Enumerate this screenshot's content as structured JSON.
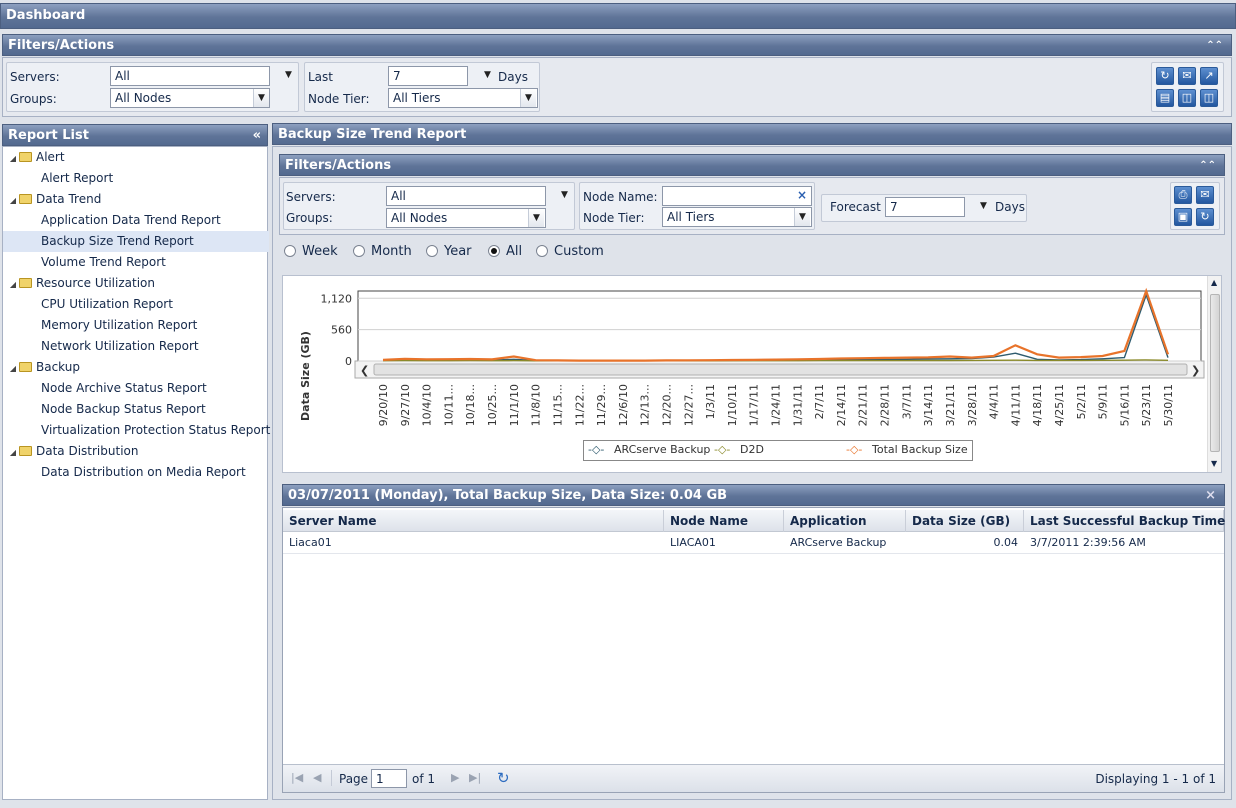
{
  "title": "Dashboard",
  "filters": {
    "title": "Filters/Actions",
    "servers_label": "Servers:",
    "servers_value": "All",
    "groups_label": "Groups:",
    "groups_value": "All Nodes",
    "last_label": "Last",
    "last_value": "7",
    "days_label": "Days",
    "node_tier_label": "Node Tier:",
    "node_tier_value": "All Tiers"
  },
  "report_list": {
    "title": "Report List",
    "items": [
      {
        "label": "Alert",
        "type": "folder"
      },
      {
        "label": "Alert Report",
        "type": "report"
      },
      {
        "label": "Data Trend",
        "type": "folder"
      },
      {
        "label": "Application Data Trend Report",
        "type": "report"
      },
      {
        "label": "Backup Size Trend Report",
        "type": "report",
        "selected": true
      },
      {
        "label": "Volume Trend Report",
        "type": "report"
      },
      {
        "label": "Resource Utilization",
        "type": "folder"
      },
      {
        "label": "CPU Utilization Report",
        "type": "report"
      },
      {
        "label": "Memory Utilization Report",
        "type": "report"
      },
      {
        "label": "Network Utilization Report",
        "type": "report"
      },
      {
        "label": "Backup",
        "type": "folder"
      },
      {
        "label": "Node Archive Status Report",
        "type": "report"
      },
      {
        "label": "Node Backup Status Report",
        "type": "report"
      },
      {
        "label": "Virtualization Protection Status Report",
        "type": "report"
      },
      {
        "label": "Data Distribution",
        "type": "folder"
      },
      {
        "label": "Data Distribution on Media Report",
        "type": "report"
      }
    ]
  },
  "report": {
    "title": "Backup Size Trend Report",
    "filters": {
      "title": "Filters/Actions",
      "servers_label": "Servers:",
      "servers_value": "All",
      "groups_label": "Groups:",
      "groups_value": "All Nodes",
      "node_name_label": "Node Name:",
      "node_name_value": "",
      "node_tier_label": "Node Tier:",
      "node_tier_value": "All Tiers",
      "forecast_label": "Forecast",
      "forecast_value": "7",
      "days_label": "Days"
    },
    "periods": [
      {
        "label": "Week",
        "selected": false
      },
      {
        "label": "Month",
        "selected": false
      },
      {
        "label": "Year",
        "selected": false
      },
      {
        "label": "All",
        "selected": true
      },
      {
        "label": "Custom",
        "selected": false
      }
    ]
  },
  "chart_data": {
    "type": "line",
    "ylabel": "Data Size (GB)",
    "xlabel": "",
    "ylim": [
      0,
      1250
    ],
    "yticks": [
      "1,120",
      "560",
      "0"
    ],
    "categories": [
      "9/20/10",
      "9/27/10",
      "10/4/10",
      "10/11...",
      "10/18...",
      "10/25...",
      "11/1/10",
      "11/8/10",
      "11/15...",
      "11/22...",
      "11/29...",
      "12/6/10",
      "12/13...",
      "12/20...",
      "12/27...",
      "1/3/11",
      "1/10/11",
      "1/17/11",
      "1/24/11",
      "1/31/11",
      "2/7/11",
      "2/14/11",
      "2/21/11",
      "2/28/11",
      "3/7/11",
      "3/14/11",
      "3/21/11",
      "3/28/11",
      "4/4/11",
      "4/11/11",
      "4/18/11",
      "4/25/11",
      "5/2/11",
      "5/9/11",
      "5/16/11",
      "5/23/11",
      "5/30/11"
    ],
    "series": [
      {
        "name": "ARCserve Backup",
        "color": "#2e5b6e",
        "values": [
          10,
          25,
          18,
          20,
          22,
          15,
          30,
          8,
          6,
          5,
          5,
          5,
          4,
          6,
          7,
          8,
          10,
          12,
          15,
          18,
          20,
          25,
          28,
          30,
          30,
          35,
          40,
          45,
          70,
          140,
          30,
          20,
          25,
          40,
          60,
          1180,
          60
        ]
      },
      {
        "name": "D2D",
        "color": "#8a8a2a",
        "values": [
          5,
          8,
          6,
          6,
          7,
          6,
          8,
          4,
          3,
          3,
          3,
          3,
          3,
          3,
          4,
          4,
          5,
          5,
          6,
          6,
          7,
          7,
          8,
          8,
          8,
          9,
          9,
          10,
          12,
          15,
          10,
          10,
          10,
          12,
          14,
          20,
          12
        ]
      },
      {
        "name": "Total Backup Size",
        "color": "#e8732a",
        "values": [
          20,
          40,
          30,
          32,
          35,
          28,
          80,
          15,
          10,
          8,
          8,
          8,
          7,
          10,
          12,
          14,
          18,
          20,
          25,
          30,
          35,
          45,
          50,
          55,
          60,
          65,
          80,
          60,
          90,
          280,
          120,
          60,
          70,
          90,
          180,
          1350,
          120
        ]
      }
    ],
    "legend_position": "bottom"
  },
  "detail": {
    "title": "03/07/2011 (Monday), Total Backup Size, Data Size: 0.04 GB",
    "columns": [
      "Server Name",
      "Node Name",
      "Application",
      "Data Size (GB)",
      "Last Successful Backup Time"
    ],
    "rows": [
      [
        "Liaca01",
        "LIACA01",
        "ARCserve Backup",
        "0.04",
        "3/7/2011 2:39:56 AM"
      ]
    ],
    "pager": {
      "page_label": "Page",
      "page_value": "1",
      "of_label": "of 1",
      "displaying": "Displaying 1 - 1 of 1"
    }
  },
  "colors": {
    "header_blue": "#5f7498",
    "selected_row": "#dde6f5",
    "total_line": "#e8732a",
    "arcserve_line": "#2e5b6e",
    "d2d_line": "#8a8a2a"
  }
}
